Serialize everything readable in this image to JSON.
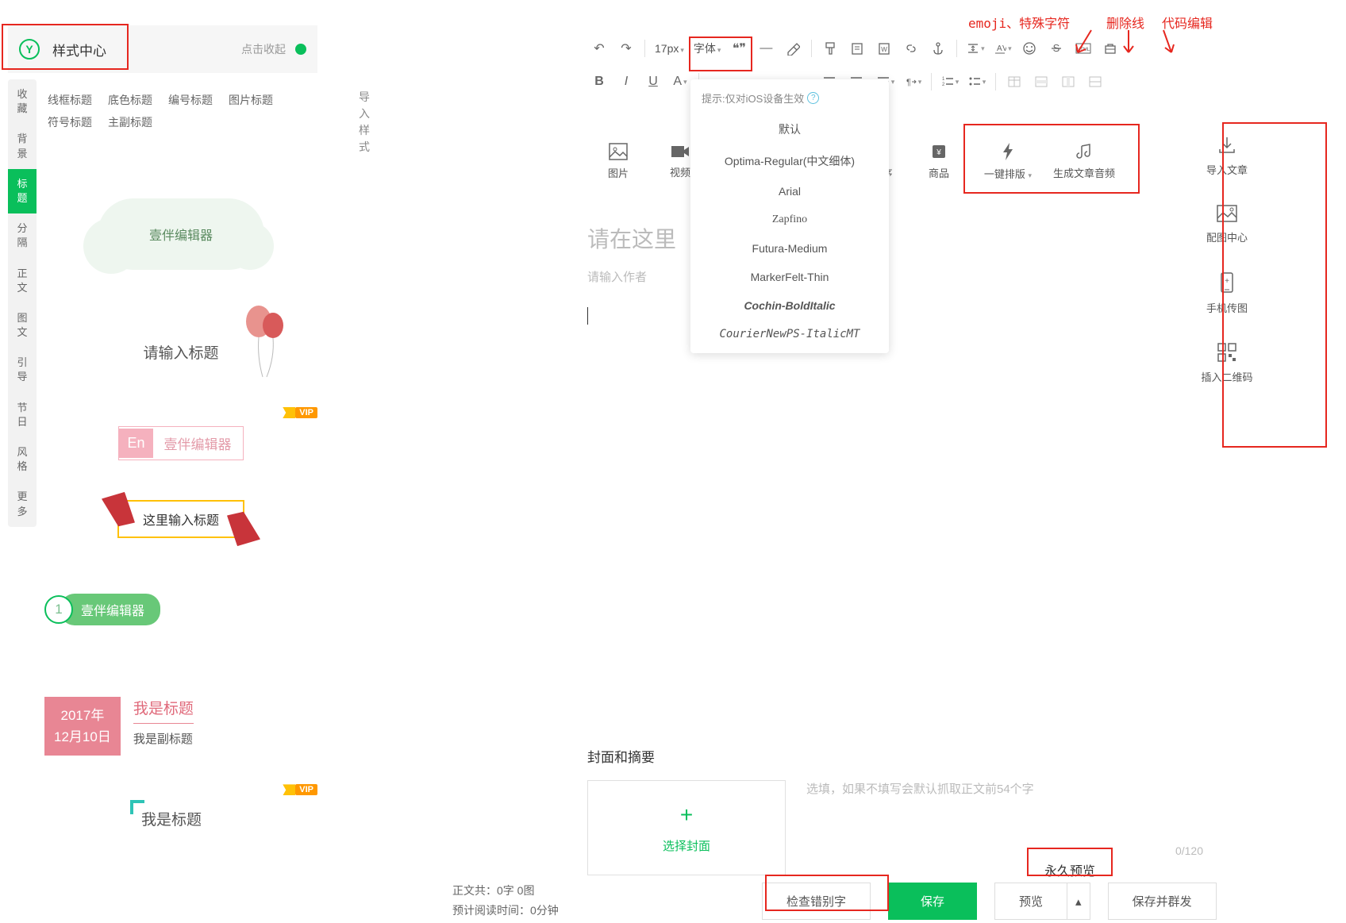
{
  "annotations": {
    "emoji": "emoji、特殊字符",
    "strike": "删除线",
    "code": "代码编辑"
  },
  "style_center": {
    "title": "样式中心",
    "collapse": "点击收起"
  },
  "left_tabs": [
    "收藏",
    "背景",
    "标题",
    "分隔",
    "正文",
    "图文",
    "引导",
    "节日",
    "风格",
    "更多"
  ],
  "style_filters": [
    "线框标题",
    "底色标题",
    "编号标题",
    "图片标题",
    "符号标题",
    "主副标题"
  ],
  "previews": {
    "cloud": "壹伴编辑器",
    "balloon": "请输入标题",
    "vip": "VIP",
    "en_badge": "En",
    "en_text": "壹伴编辑器",
    "ribbon": "这里输入标题",
    "num": "1",
    "num_text": "壹伴编辑器",
    "date_year": "2017年",
    "date_day": "12月10日",
    "date_main": "我是标题",
    "date_sub": "我是副标题",
    "bracket": "我是标题"
  },
  "import_style": "导入样式",
  "toolbar": {
    "font_size": "17px",
    "font": "字体"
  },
  "font_dropdown": {
    "tip": "提示:仅对iOS设备生效",
    "items": [
      "默认",
      "Optima-Regular(中文细体)",
      "Arial",
      "Zapfino",
      "Futura-Medium",
      "MarkerFelt-Thin",
      "Cochin-BoldItalic",
      "CourierNewPS-ItalicMT"
    ]
  },
  "insert_row": {
    "image": "图片",
    "video": "视频",
    "miniapp": "小程序",
    "product": "商品",
    "autolayout": "一键排版",
    "audio": "生成文章音频"
  },
  "editor": {
    "title_ph": "请在这里",
    "author_ph": "请输入作者"
  },
  "right_panel": {
    "import": "导入文章",
    "imgcenter": "配图中心",
    "phone": "手机传图",
    "qrcode": "插入二维码"
  },
  "cover": {
    "section_title": "封面和摘要",
    "upload": "选择封面",
    "summary_ph": "选填，如果不填写会默认抓取正文前54个字",
    "count": "0/120"
  },
  "stats": {
    "words_label": "正文共：",
    "words_value": "0字 0图",
    "time_label": "预计阅读时间：",
    "time_value": "0分钟"
  },
  "buttons": {
    "check": "检查错别字",
    "save": "保存",
    "preview": "预览",
    "perm_preview": "永久预览",
    "save_send": "保存并群发"
  }
}
